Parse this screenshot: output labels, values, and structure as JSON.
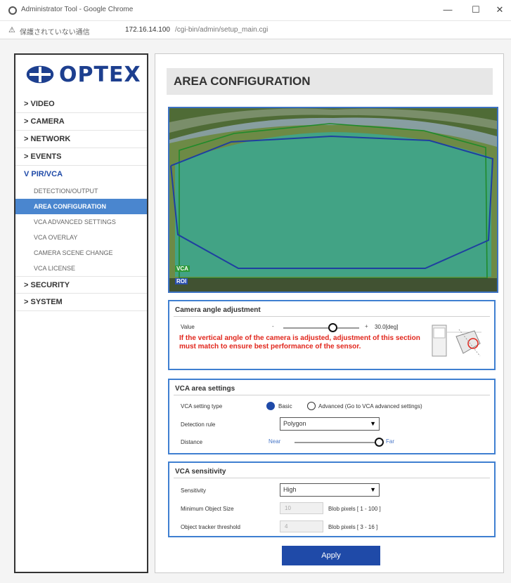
{
  "browser": {
    "window_title": "Administrator Tool - Google Chrome",
    "security_label": "保護されていない通信",
    "url_host": "172.16.14.100",
    "url_path": "/cgi-bin/admin/setup_main.cgi",
    "minimize_glyph": "—",
    "maximize_glyph": "☐",
    "close_glyph": "✕"
  },
  "sidebar": {
    "logo_text": "OPTEX",
    "menu": [
      {
        "label": "> VIDEO"
      },
      {
        "label": "> CAMERA"
      },
      {
        "label": "> NETWORK"
      },
      {
        "label": "> EVENTS"
      },
      {
        "label": "V PIR/VCA"
      }
    ],
    "submenu": [
      {
        "label": "DETECTION/OUTPUT"
      },
      {
        "label": "AREA CONFIGURATION"
      },
      {
        "label": "VCA ADVANCED SETTINGS"
      },
      {
        "label": "VCA OVERLAY"
      },
      {
        "label": "CAMERA SCENE CHANGE"
      },
      {
        "label": "VCA LICENSE"
      }
    ],
    "menu_after": [
      {
        "label": "> SECURITY"
      },
      {
        "label": "> SYSTEM"
      }
    ],
    "active_item": "AREA CONFIGURATION"
  },
  "main": {
    "title": "AREA CONFIGURATION",
    "camera": {
      "badge_vca": "VCA",
      "badge_roi": "ROI"
    },
    "angle_panel": {
      "title": "Camera angle adjustment",
      "value_label": "Value",
      "minus": "-",
      "plus": "+",
      "value_text": "30.0[deg]",
      "slider_fraction": 0.65,
      "warning": "If the vertical angle of the camera is adjusted, adjustment of this section must match to ensure best performance of the sensor."
    },
    "area_panel": {
      "title": "VCA area settings",
      "setting_type_label": "VCA setting type",
      "basic_label": "Basic",
      "advanced_label": "Advanced (Go to VCA advanced settings)",
      "selected_type": "Basic",
      "detection_rule_label": "Detection rule",
      "detection_rule_value": "Polygon",
      "distance_label": "Distance",
      "near_label": "Near",
      "far_label": "Far",
      "distance_fraction": 1.0
    },
    "sensitivity_panel": {
      "title": "VCA sensitivity",
      "sensitivity_label": "Sensitivity",
      "sensitivity_value": "High",
      "min_object_label": "Minimum Object Size",
      "min_object_value": "10",
      "min_object_unit": "Blob pixels [ 1 - 100 ]",
      "tracker_label": "Object tracker threshold",
      "tracker_value": "4",
      "tracker_unit": "Blob pixels [ 3 - 16 ]"
    },
    "apply_label": "Apply"
  },
  "colors": {
    "accent_blue": "#1f4aa8",
    "active_menu_bg": "#4a86cf",
    "warning_red": "#e1261c",
    "detection_area": "#3fa58b",
    "polygon_green": "#1f8a2a",
    "polygon_blue": "#1f3fa0"
  }
}
